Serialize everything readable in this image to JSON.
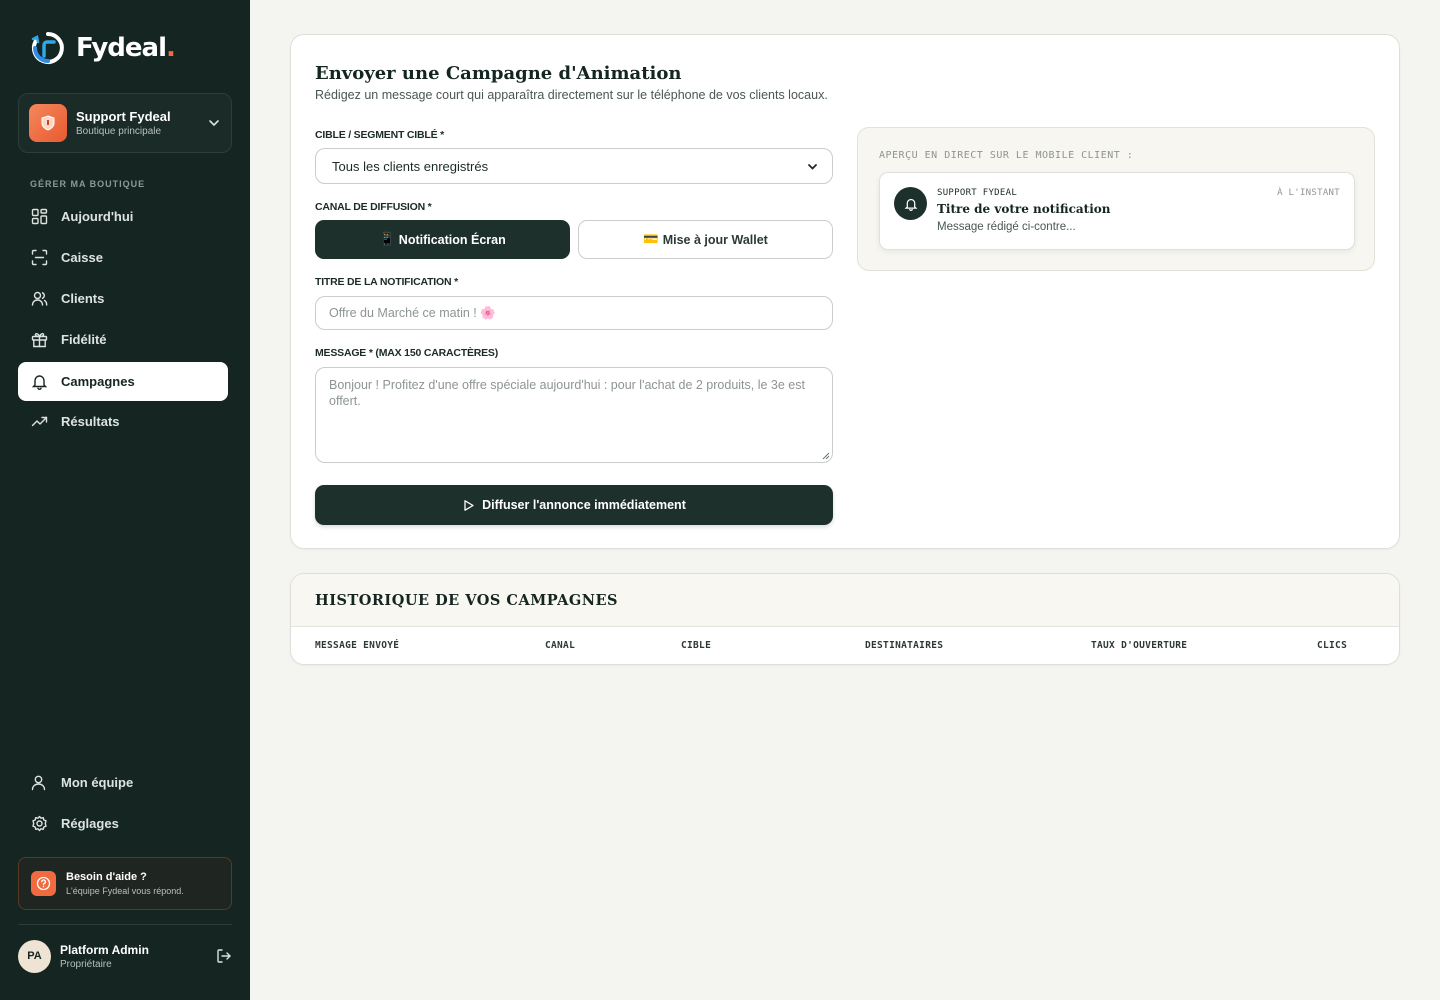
{
  "brand": {
    "name": "Fydeal",
    "dot": ".",
    "accent": "#f26a3f",
    "sidebar_bg": "#152521"
  },
  "store": {
    "name": "Support Fydeal",
    "subtitle": "Boutique principale"
  },
  "sidebar": {
    "section_label": "GÉRER MA BOUTIQUE",
    "items": [
      {
        "label": "Aujourd'hui",
        "icon": "dashboard-icon"
      },
      {
        "label": "Caisse",
        "icon": "scan-icon"
      },
      {
        "label": "Clients",
        "icon": "users-icon"
      },
      {
        "label": "Fidélité",
        "icon": "gift-icon"
      },
      {
        "label": "Campagnes",
        "icon": "bell-icon",
        "active": true
      },
      {
        "label": "Résultats",
        "icon": "trend-icon"
      }
    ],
    "bottom_items": [
      {
        "label": "Mon équipe",
        "icon": "user-icon"
      },
      {
        "label": "Réglages",
        "icon": "gear-icon"
      }
    ],
    "help": {
      "title": "Besoin d'aide ?",
      "subtitle": "L'équipe Fydeal vous répond."
    },
    "user": {
      "initials": "PA",
      "name": "Platform Admin",
      "role": "Propriétaire"
    }
  },
  "campaign": {
    "title": "Envoyer une Campagne d'Animation",
    "subtitle": "Rédigez un message court qui apparaîtra directement sur le téléphone de vos clients locaux.",
    "target_label": "CIBLE / SEGMENT CIBLÉ *",
    "target_value": "Tous les clients enregistrés",
    "channel_label": "CANAL DE DIFFUSION *",
    "channel_screen": "Notification Écran",
    "channel_screen_emoji": "📱",
    "channel_wallet": "Mise à jour Wallet",
    "channel_wallet_emoji": "💳",
    "title_label": "TITRE DE LA NOTIFICATION *",
    "title_placeholder": "Offre du Marché ce matin ! 🌸",
    "message_label": "MESSAGE * (MAX 150 CARACTÈRES)",
    "message_placeholder": "Bonjour ! Profitez d'une offre spéciale aujourd'hui : pour l'achat de 2 produits, le 3e est offert.",
    "submit": "Diffuser l'annonce immédiatement"
  },
  "preview": {
    "label": "APERÇU EN DIRECT SUR LE MOBILE CLIENT :",
    "app": "SUPPORT FYDEAL",
    "time": "À L'INSTANT",
    "title": "Titre de votre notification",
    "body": "Message rédigé ci-contre..."
  },
  "history": {
    "title": "HISTORIQUE DE VOS CAMPAGNES",
    "columns": [
      "MESSAGE ENVOYÉ",
      "CANAL",
      "CIBLE",
      "DESTINATAIRES",
      "TAUX D'OUVERTURE",
      "CLICS"
    ]
  }
}
